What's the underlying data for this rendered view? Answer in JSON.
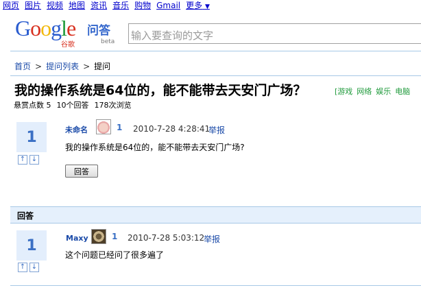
{
  "topnav": [
    "网页",
    "图片",
    "视频",
    "地图",
    "资讯",
    "音乐",
    "购物",
    "Gmail",
    "更多"
  ],
  "logo": {
    "letters": [
      "G",
      "o",
      "o",
      "g",
      "l",
      "e"
    ],
    "wenda": "问答",
    "sub": "谷歌",
    "beta": "beta"
  },
  "search": {
    "placeholder": "输入要查询的文字",
    "value": ""
  },
  "breadcrumb": {
    "items": [
      "首页",
      "提问列表",
      "提问"
    ],
    "separator": ">"
  },
  "question": {
    "title": "我的操作系统是64位的，能不能带去天安门广场？",
    "tags": [
      "游戏",
      "网络",
      "娱乐",
      "电脑"
    ],
    "tags_bracket": "[",
    "stats": [
      "悬赏点数 5",
      "10个回答",
      "178次浏览"
    ],
    "votes": "1",
    "author": "未命名",
    "level": "1",
    "time": "2010-7-28 4:28:41",
    "report": "举报",
    "body": "我的操作系统是64位的，能不能带去天安门广场?",
    "reply_button": "回答"
  },
  "answers_header": "回答",
  "answers": [
    {
      "votes": "1",
      "author": "Maxy",
      "level": "1",
      "time": "2010-7-28 5:03:12",
      "report": "举报",
      "body": "这个问题已经问了很多遍了"
    }
  ],
  "icons": {
    "up": "arrow-up-icon",
    "down": "arrow-down-icon",
    "more_arrow": "triangle-down-icon"
  },
  "colors": {
    "link": "#0000cc",
    "accent_blue": "#3a6fc4",
    "vote_bg": "#e3eefc",
    "divider": "#a6c8e6",
    "tag_green": "#1f9a3b"
  }
}
